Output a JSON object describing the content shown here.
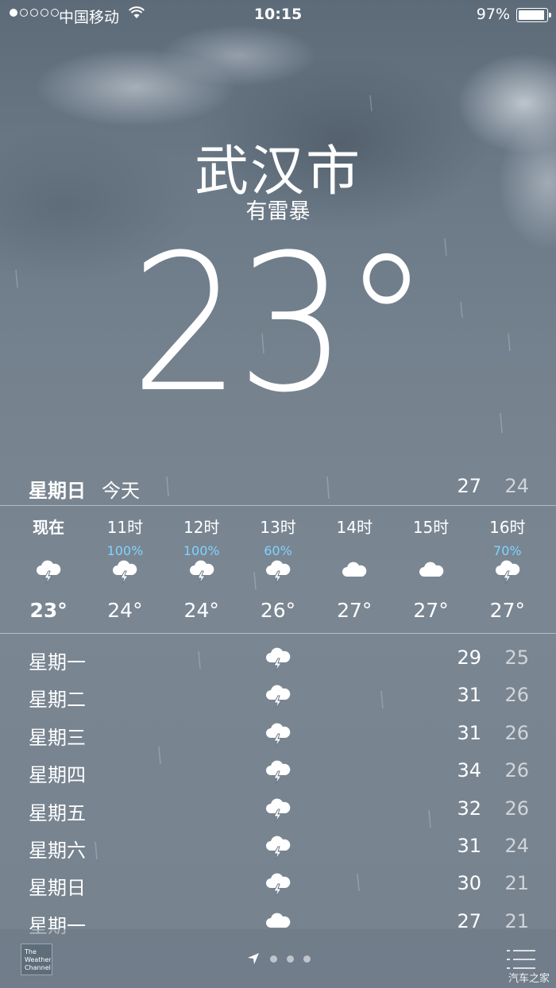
{
  "status_bar": {
    "signal_dots": [
      true,
      false,
      false,
      false,
      false
    ],
    "carrier": "中国移动",
    "time": "10:15",
    "battery_percent": "97%",
    "battery_level": 0.97
  },
  "header": {
    "city": "武汉市",
    "condition": "有雷暴",
    "temperature": "23°"
  },
  "today": {
    "day": "星期日",
    "label": "今天",
    "high": "27",
    "low": "24"
  },
  "hourly": [
    {
      "time": "现在",
      "precip": "",
      "icon": "thunderstorm-icon",
      "temp": "23°"
    },
    {
      "time": "11时",
      "precip": "100%",
      "icon": "thunderstorm-icon",
      "temp": "24°"
    },
    {
      "time": "12时",
      "precip": "100%",
      "icon": "thunderstorm-icon",
      "temp": "24°"
    },
    {
      "time": "13时",
      "precip": "60%",
      "icon": "thunderstorm-icon",
      "temp": "26°"
    },
    {
      "time": "14时",
      "precip": "",
      "icon": "cloud-icon",
      "temp": "27°"
    },
    {
      "time": "15时",
      "precip": "",
      "icon": "cloud-icon",
      "temp": "27°"
    },
    {
      "time": "16时",
      "precip": "70%",
      "icon": "thunderstorm-icon",
      "temp": "27°"
    }
  ],
  "daily": [
    {
      "day": "星期一",
      "icon": "thunderstorm-icon",
      "high": "29",
      "low": "25"
    },
    {
      "day": "星期二",
      "icon": "thunderstorm-icon",
      "high": "31",
      "low": "26"
    },
    {
      "day": "星期三",
      "icon": "thunderstorm-icon",
      "high": "31",
      "low": "26"
    },
    {
      "day": "星期四",
      "icon": "thunderstorm-icon",
      "high": "34",
      "low": "26"
    },
    {
      "day": "星期五",
      "icon": "thunderstorm-icon",
      "high": "32",
      "low": "26"
    },
    {
      "day": "星期六",
      "icon": "thunderstorm-icon",
      "high": "31",
      "low": "24"
    },
    {
      "day": "星期日",
      "icon": "thunderstorm-icon",
      "high": "30",
      "low": "21"
    },
    {
      "day": "星期一",
      "icon": "cloud-icon",
      "high": "27",
      "low": "21"
    }
  ],
  "bottom_bar": {
    "weather_channel_logo": "The Weather Channel",
    "page_count": 3,
    "watermark": "汽车之家"
  },
  "colors": {
    "precip_blue": "#7fd4ff",
    "text": "#ffffff"
  }
}
